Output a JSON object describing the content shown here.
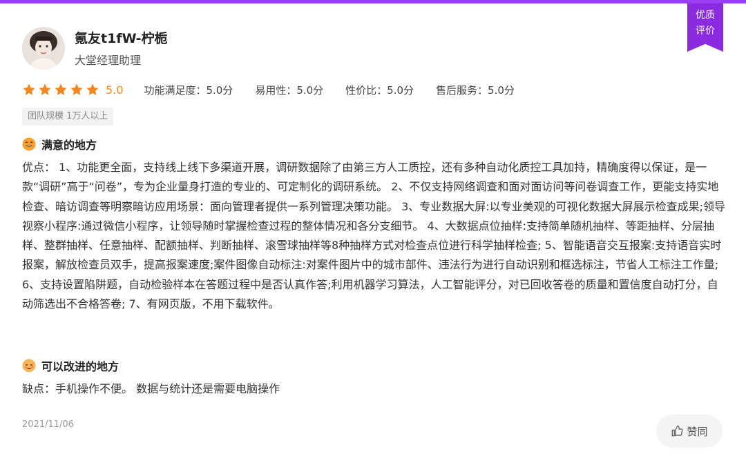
{
  "badge": {
    "line1": "优质",
    "line2": "评价"
  },
  "reviewer": {
    "name": "氪友t1fW-柠栀",
    "title": "大堂经理助理"
  },
  "rating": {
    "stars": 5,
    "score": "5.0",
    "metrics": [
      {
        "text": "功能满足度：5.0分"
      },
      {
        "text": "易用性：5.0分"
      },
      {
        "text": "性价比：5.0分"
      },
      {
        "text": "售后服务：5.0分"
      }
    ]
  },
  "tag": "团队规模 1万人以上",
  "pros": {
    "heading": "满意的地方",
    "text": "优点： 1、功能更全面，支持线上线下多渠道开展，调研数据除了由第三方人工质控，还有多种自动化质控工具加持，精确度得以保证，是一款“调研”高于“问卷”，专为企业量身打造的专业的、可定制化的调研系统。 2、不仅支持网络调查和面对面访问等问卷调查工作，更能支持实地检查、暗访调查等明察暗访应用场景：面向管理者提供一系列管理决策功能。 3、专业数据大屏:以专业美观的可视化数据大屏展示检查成果;领导视察小程序:通过微信小程序，让领导随时掌握检查过程的整体情况和各分支细节。 4、大数据点位抽样:支持简单随机抽样、等距抽样、分层抽样、整群抽样、任意抽样、配额抽样、判断抽样、滚雪球抽样等8种抽样方式对检查点位进行科学抽样检查; 5、智能语音交互报案:支持语音实时报案，解放检查员双手，提高报案速度;案件图像自动标注:对案件图片中的城市部件、违法行为进行自动识别和框选标注，节省人工标注工作量; 6、支持设置陷阱题，自动检验样本在答题过程中是否认真作答;利用机器学习算法，人工智能评分，对已回收答卷的质量和置信度自动打分，自动筛选出不合格答卷; 7、有网页版，不用下载软件。"
  },
  "cons": {
    "heading": "可以改进的地方",
    "text": "缺点：手机操作不便。 数据与统计还是需要电脑操作"
  },
  "date": "2021/11/06",
  "like_label": "赞同",
  "colors": {
    "accent": "#8a2be2",
    "star": "#f5861f"
  }
}
